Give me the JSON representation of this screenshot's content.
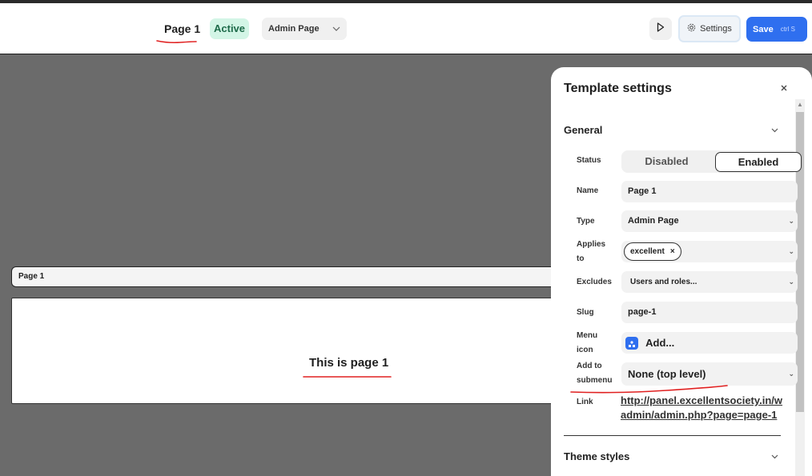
{
  "header": {
    "page_title": "Page 1",
    "status_badge": "Active",
    "type_select": "Admin Page",
    "settings_label": "Settings",
    "save_label": "Save",
    "save_shortcut": "ctrl S"
  },
  "canvas": {
    "page_bar_label": "Page 1",
    "content_text": "This is page 1"
  },
  "panel": {
    "title": "Template settings",
    "general_heading": "General",
    "fields": {
      "status_label": "Status",
      "status_disabled": "Disabled",
      "status_enabled": "Enabled",
      "name_label": "Name",
      "name_value": "Page 1",
      "type_label": "Type",
      "type_value": "Admin Page",
      "applies_label_1": "Applies",
      "applies_label_2": "to",
      "applies_chip": "excellent",
      "excludes_label": "Excludes",
      "excludes_value": "Users and roles...",
      "slug_label": "Slug",
      "slug_value": "page-1",
      "menu_icon_label_1": "Menu",
      "menu_icon_label_2": "icon",
      "menu_icon_value": "Add...",
      "submenu_label_1": "Add to",
      "submenu_label_2": "submenu",
      "submenu_value": "None (top level)",
      "link_label": "Link",
      "link_line_1": "http://panel.excellentsociety.in/w",
      "link_line_2": "admin/admin.php?page=page-1"
    },
    "theme_styles_heading": "Theme styles"
  },
  "colors": {
    "accent": "#2f6fef",
    "active_badge_bg": "#d3f5e6",
    "canvas_bg": "#6b6b6b",
    "annotation_red": "#e02020"
  },
  "icons": [
    "play-icon",
    "gear-icon",
    "close-icon",
    "chevron-down-icon",
    "menu-icon"
  ]
}
